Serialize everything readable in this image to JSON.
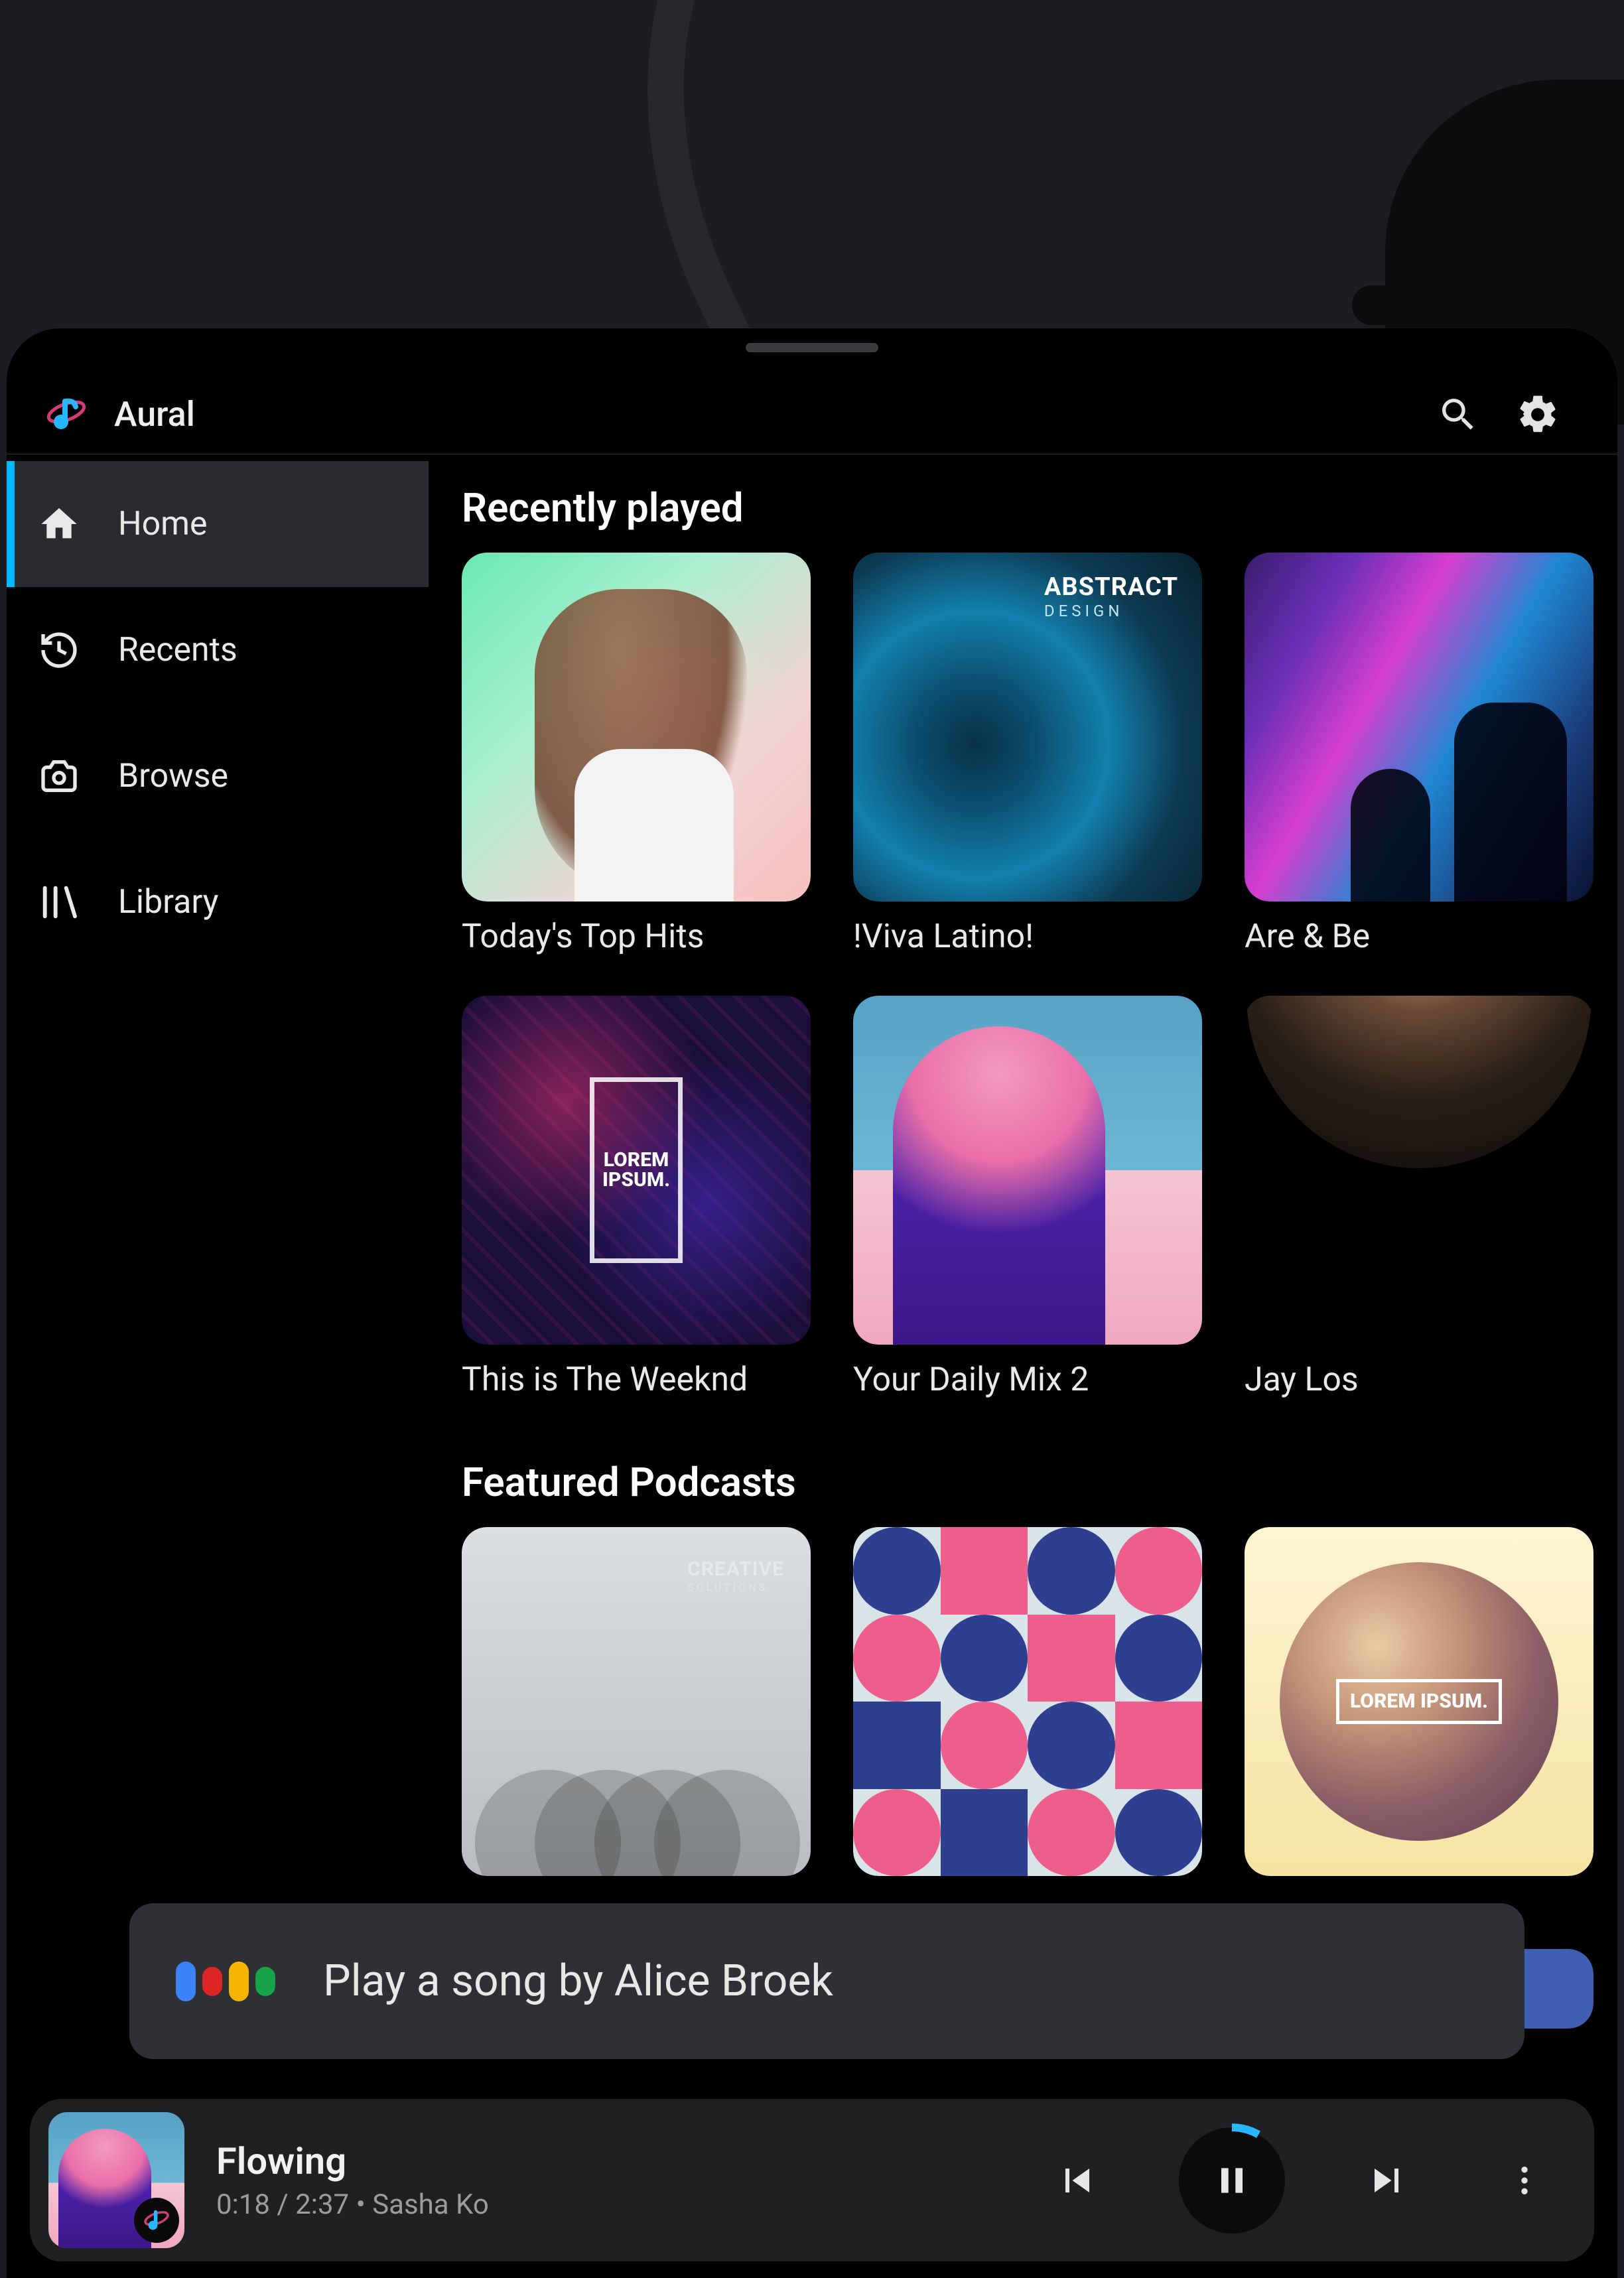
{
  "app": {
    "name": "Aural"
  },
  "topbar": {
    "search_icon": "search",
    "settings_icon": "settings"
  },
  "sidebar": {
    "items": [
      {
        "id": "home",
        "label": "Home",
        "icon": "home-icon",
        "active": true
      },
      {
        "id": "recents",
        "label": "Recents",
        "icon": "history-icon",
        "active": false
      },
      {
        "id": "browse",
        "label": "Browse",
        "icon": "camera-icon",
        "active": false
      },
      {
        "id": "library",
        "label": "Library",
        "icon": "library-icon",
        "active": false
      }
    ]
  },
  "sections": {
    "recent_title": "Recently played",
    "recent_items": [
      {
        "label": "Today's Top Hits"
      },
      {
        "label": "!Viva Latino!",
        "badge_main": "ABSTRACT",
        "badge_sub": "DESIGN"
      },
      {
        "label": "Are & Be"
      },
      {
        "label": "This is The Weeknd",
        "box_text": "LOREM IPSUM."
      },
      {
        "label": "Your Daily Mix 2"
      },
      {
        "label": "Jay Los"
      }
    ],
    "podcasts_title": "Featured Podcasts",
    "podcast_items": [
      {
        "badge_main": "CREATIVE",
        "badge_sub": "SOLUTIONS"
      },
      {},
      {
        "tag_text": "LOREM IPSUM."
      }
    ]
  },
  "voice": {
    "query": "Play a song by Alice Broek"
  },
  "player": {
    "track": "Flowing",
    "elapsed": "0:18",
    "duration": "2:37",
    "separator": " / ",
    "dot": " • ",
    "artist": "Sasha Ko"
  }
}
